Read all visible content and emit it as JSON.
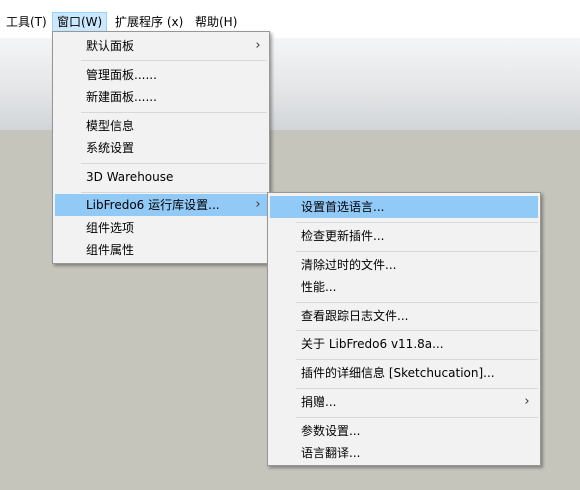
{
  "menubar": {
    "items": [
      "工具(T)",
      "窗口(W)",
      "扩展程序 (x)",
      "帮助(H)"
    ]
  },
  "window_menu": {
    "items": [
      {
        "label": "默认面板",
        "submenu": true
      },
      {
        "label": "管理面板......"
      },
      {
        "label": "新建面板......"
      },
      {
        "label": "模型信息"
      },
      {
        "label": "系统设置"
      },
      {
        "label": "3D Warehouse"
      },
      {
        "label": "LibFredo6 运行库设置...",
        "submenu": true,
        "highlighted": true
      },
      {
        "label": "组件选项"
      },
      {
        "label": "组件属性"
      }
    ]
  },
  "libfredo_submenu": {
    "items": [
      {
        "label": "设置首选语言...",
        "highlighted": true
      },
      {
        "label": "检查更新插件..."
      },
      {
        "label": "清除过时的文件..."
      },
      {
        "label": "性能..."
      },
      {
        "label": "查看跟踪日志文件..."
      },
      {
        "label": "关于 LibFredo6 v11.8a..."
      },
      {
        "label": "插件的详细信息 [Sketchucation]..."
      },
      {
        "label": "捐赠...",
        "submenu": true
      },
      {
        "label": "参数设置..."
      },
      {
        "label": "语言翻译..."
      }
    ]
  },
  "icons": {
    "submenu_arrow": "›"
  },
  "colors": {
    "highlight": "#91c9f7",
    "menubar_active_bg": "#cce8ff",
    "ground": "#c6c5bc",
    "menu_bg": "#f2f2f2"
  }
}
